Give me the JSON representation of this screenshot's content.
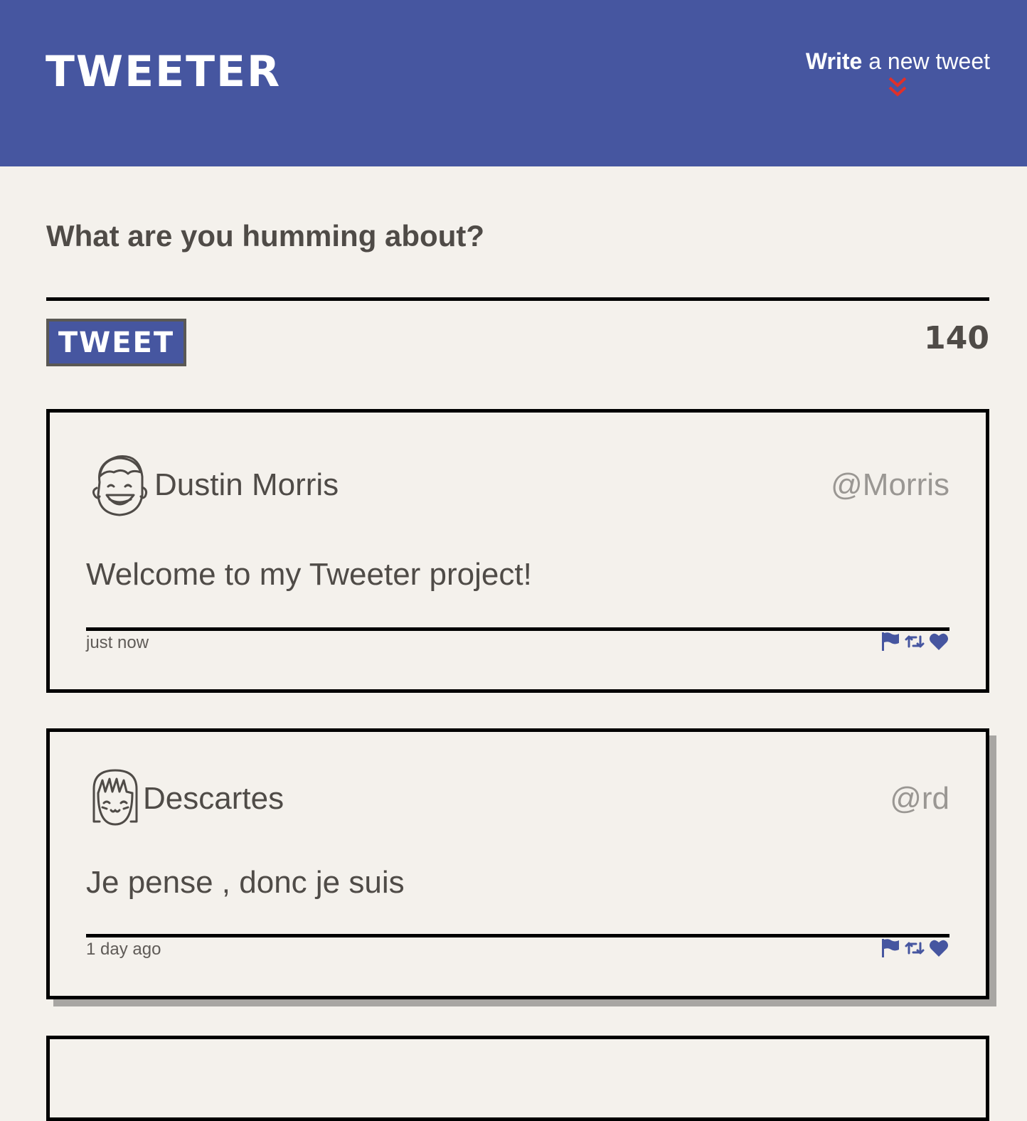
{
  "nav": {
    "brand": "TWEETER",
    "compose_toggle": {
      "strong": "Write",
      "rest": " a new tweet",
      "icon": "double-chevron-down-icon",
      "icon_color": "#e0302a"
    },
    "background": "#4656a0"
  },
  "composer": {
    "title": "What are you humming about?",
    "textarea_value": "",
    "button_label": "TWEET",
    "counter": "140"
  },
  "tweets": [
    {
      "avatar": "smiling-boy-avatar-icon",
      "name": "Dustin Morris",
      "handle": "@Morris",
      "content": "Welcome to my Tweeter project!",
      "timestamp": "just now",
      "actions": [
        "flag-icon",
        "retweet-icon",
        "heart-icon"
      ]
    },
    {
      "avatar": "smiling-girl-avatar-icon",
      "name": "Descartes",
      "handle": "@rd",
      "content": "Je pense , donc je suis",
      "timestamp": "1 day ago",
      "actions": [
        "flag-icon",
        "retweet-icon",
        "heart-icon"
      ]
    }
  ],
  "colors": {
    "accent": "#4656a0",
    "background": "#f4f1ec",
    "text": "#4f4b47",
    "handle": "#9a9793",
    "chevron": "#e0302a"
  }
}
